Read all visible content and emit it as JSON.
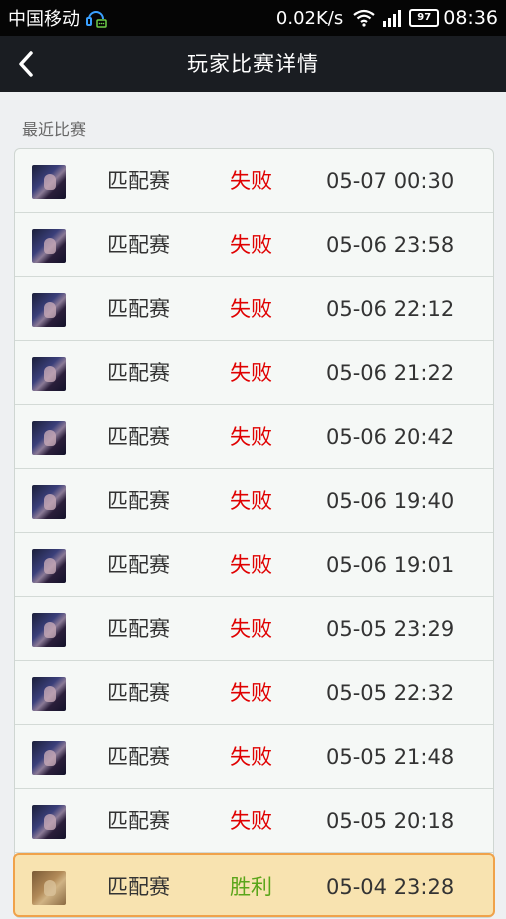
{
  "status_bar": {
    "carrier": "中国移动",
    "net_speed": "0.02K/s",
    "battery": "97",
    "time": "08:36"
  },
  "header": {
    "title": "玩家比赛详情"
  },
  "section": {
    "label": "最近比赛"
  },
  "colors": {
    "loss": "#e00000",
    "win": "#5aa51a"
  },
  "matches": [
    {
      "mode": "匹配赛",
      "result": "失败",
      "outcome": "loss",
      "time": "05-07 00:30"
    },
    {
      "mode": "匹配赛",
      "result": "失败",
      "outcome": "loss",
      "time": "05-06 23:58"
    },
    {
      "mode": "匹配赛",
      "result": "失败",
      "outcome": "loss",
      "time": "05-06 22:12"
    },
    {
      "mode": "匹配赛",
      "result": "失败",
      "outcome": "loss",
      "time": "05-06 21:22"
    },
    {
      "mode": "匹配赛",
      "result": "失败",
      "outcome": "loss",
      "time": "05-06 20:42"
    },
    {
      "mode": "匹配赛",
      "result": "失败",
      "outcome": "loss",
      "time": "05-06 19:40"
    },
    {
      "mode": "匹配赛",
      "result": "失败",
      "outcome": "loss",
      "time": "05-06 19:01"
    },
    {
      "mode": "匹配赛",
      "result": "失败",
      "outcome": "loss",
      "time": "05-05 23:29"
    },
    {
      "mode": "匹配赛",
      "result": "失败",
      "outcome": "loss",
      "time": "05-05 22:32"
    },
    {
      "mode": "匹配赛",
      "result": "失败",
      "outcome": "loss",
      "time": "05-05 21:48"
    },
    {
      "mode": "匹配赛",
      "result": "失败",
      "outcome": "loss",
      "time": "05-05 20:18"
    },
    {
      "mode": "匹配赛",
      "result": "胜利",
      "outcome": "win",
      "time": "05-04 23:28"
    }
  ]
}
